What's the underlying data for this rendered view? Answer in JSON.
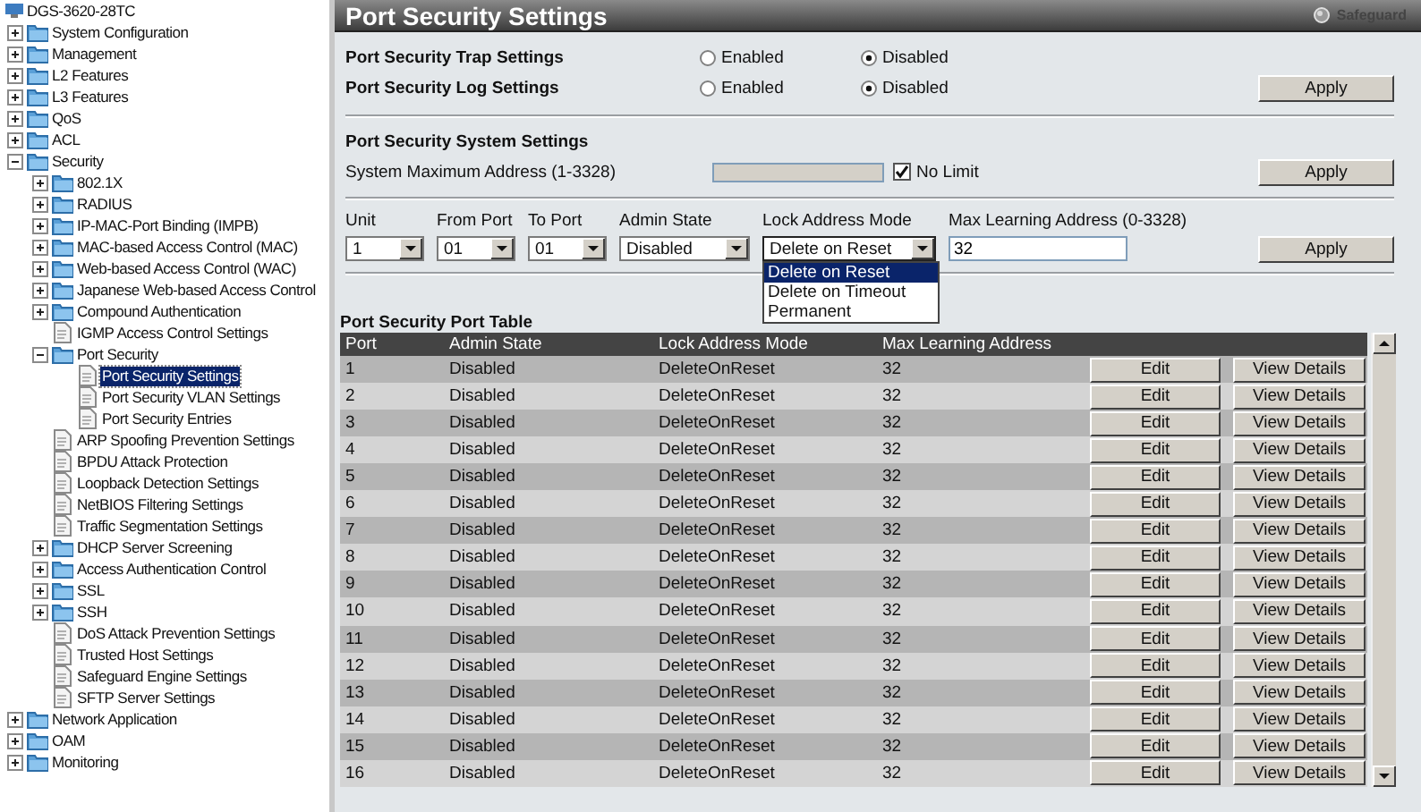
{
  "tree": {
    "root": "DGS-3620-28TC",
    "items": [
      {
        "label": "System Configuration",
        "kind": "folder",
        "expanded": false,
        "selected": false
      },
      {
        "label": "Management",
        "kind": "folder",
        "expanded": false,
        "selected": false
      },
      {
        "label": "L2 Features",
        "kind": "folder",
        "expanded": false,
        "selected": false
      },
      {
        "label": "L3 Features",
        "kind": "folder",
        "expanded": false,
        "selected": false
      },
      {
        "label": "QoS",
        "kind": "folder",
        "expanded": false,
        "selected": false
      },
      {
        "label": "ACL",
        "kind": "folder",
        "expanded": false,
        "selected": false
      },
      {
        "label": "Security",
        "kind": "folder",
        "expanded": true,
        "selected": false,
        "children": [
          {
            "label": "802.1X",
            "kind": "folder",
            "expanded": false,
            "selected": false
          },
          {
            "label": "RADIUS",
            "kind": "folder",
            "expanded": false,
            "selected": false
          },
          {
            "label": "IP-MAC-Port Binding (IMPB)",
            "kind": "folder",
            "expanded": false,
            "selected": false
          },
          {
            "label": "MAC-based Access Control (MAC)",
            "kind": "folder",
            "expanded": false,
            "selected": false
          },
          {
            "label": "Web-based Access Control (WAC)",
            "kind": "folder",
            "expanded": false,
            "selected": false
          },
          {
            "label": "Japanese Web-based Access Control",
            "kind": "folder",
            "expanded": false,
            "selected": false
          },
          {
            "label": "Compound Authentication",
            "kind": "folder",
            "expanded": false,
            "selected": false
          },
          {
            "label": "IGMP Access Control Settings",
            "kind": "page",
            "selected": false
          },
          {
            "label": "Port Security",
            "kind": "folder",
            "expanded": true,
            "selected": false,
            "children": [
              {
                "label": "Port Security Settings",
                "kind": "page",
                "selected": true
              },
              {
                "label": "Port Security VLAN Settings",
                "kind": "page",
                "selected": false
              },
              {
                "label": "Port Security Entries",
                "kind": "page",
                "selected": false
              }
            ]
          },
          {
            "label": "ARP Spoofing Prevention Settings",
            "kind": "page",
            "selected": false
          },
          {
            "label": "BPDU Attack Protection",
            "kind": "page",
            "selected": false
          },
          {
            "label": "Loopback Detection Settings",
            "kind": "page",
            "selected": false
          },
          {
            "label": "NetBIOS Filtering Settings",
            "kind": "page",
            "selected": false
          },
          {
            "label": "Traffic Segmentation Settings",
            "kind": "page",
            "selected": false
          },
          {
            "label": "DHCP Server Screening",
            "kind": "folder",
            "expanded": false,
            "selected": false
          },
          {
            "label": "Access Authentication Control",
            "kind": "folder",
            "expanded": false,
            "selected": false
          },
          {
            "label": "SSL",
            "kind": "folder",
            "expanded": false,
            "selected": false
          },
          {
            "label": "SSH",
            "kind": "folder",
            "expanded": false,
            "selected": false
          },
          {
            "label": "DoS Attack Prevention Settings",
            "kind": "page",
            "selected": false
          },
          {
            "label": "Trusted Host Settings",
            "kind": "page",
            "selected": false
          },
          {
            "label": "Safeguard Engine Settings",
            "kind": "page",
            "selected": false
          },
          {
            "label": "SFTP Server Settings",
            "kind": "page",
            "selected": false
          }
        ]
      },
      {
        "label": "Network Application",
        "kind": "folder",
        "expanded": false,
        "selected": false
      },
      {
        "label": "OAM",
        "kind": "folder",
        "expanded": false,
        "selected": false
      },
      {
        "label": "Monitoring",
        "kind": "folder",
        "expanded": false,
        "selected": false
      }
    ]
  },
  "page": {
    "title": "Port Security Settings",
    "safeguard": "Safeguard"
  },
  "global_settings": {
    "rows": [
      {
        "label": "Port Security Trap Settings",
        "options": [
          {
            "label": "Enabled",
            "selected": false
          },
          {
            "label": "Disabled",
            "selected": true
          }
        ]
      },
      {
        "label": "Port Security Log Settings",
        "options": [
          {
            "label": "Enabled",
            "selected": false
          },
          {
            "label": "Disabled",
            "selected": true
          }
        ]
      }
    ],
    "apply": "Apply"
  },
  "system_settings": {
    "heading": "Port Security System Settings",
    "label": "System Maximum Address (1-3328)",
    "no_limit": {
      "label": "No Limit",
      "checked": true
    },
    "apply": "Apply"
  },
  "port_form": {
    "fields": [
      {
        "label": "Unit",
        "kind": "select",
        "value": "1",
        "open": false
      },
      {
        "label": "From Port",
        "kind": "select",
        "value": "01",
        "open": false
      },
      {
        "label": "To Port",
        "kind": "select",
        "value": "01",
        "open": false
      },
      {
        "label": "Admin State",
        "kind": "select",
        "value": "Disabled",
        "open": false
      },
      {
        "label": "Lock Address Mode",
        "kind": "select",
        "value": "Delete on Reset",
        "open": true,
        "options": [
          {
            "label": "Delete on Reset",
            "selected": true
          },
          {
            "label": "Delete on Timeout",
            "selected": false
          },
          {
            "label": "Permanent",
            "selected": false
          }
        ]
      },
      {
        "label": "Max Learning Address (0-3328)",
        "kind": "input",
        "value": "32"
      }
    ],
    "apply": "Apply"
  },
  "port_table": {
    "title": "Port Security Port Table",
    "columns": [
      "Port",
      "Admin State",
      "Lock Address Mode",
      "Max Learning Address"
    ],
    "rows": [
      {
        "port": "1",
        "admin_state": "Disabled",
        "lock_mode": "DeleteOnReset",
        "max": "32",
        "edit": "Edit",
        "view": "View Details"
      },
      {
        "port": "2",
        "admin_state": "Disabled",
        "lock_mode": "DeleteOnReset",
        "max": "32",
        "edit": "Edit",
        "view": "View Details"
      },
      {
        "port": "3",
        "admin_state": "Disabled",
        "lock_mode": "DeleteOnReset",
        "max": "32",
        "edit": "Edit",
        "view": "View Details"
      },
      {
        "port": "4",
        "admin_state": "Disabled",
        "lock_mode": "DeleteOnReset",
        "max": "32",
        "edit": "Edit",
        "view": "View Details"
      },
      {
        "port": "5",
        "admin_state": "Disabled",
        "lock_mode": "DeleteOnReset",
        "max": "32",
        "edit": "Edit",
        "view": "View Details"
      },
      {
        "port": "6",
        "admin_state": "Disabled",
        "lock_mode": "DeleteOnReset",
        "max": "32",
        "edit": "Edit",
        "view": "View Details"
      },
      {
        "port": "7",
        "admin_state": "Disabled",
        "lock_mode": "DeleteOnReset",
        "max": "32",
        "edit": "Edit",
        "view": "View Details"
      },
      {
        "port": "8",
        "admin_state": "Disabled",
        "lock_mode": "DeleteOnReset",
        "max": "32",
        "edit": "Edit",
        "view": "View Details"
      },
      {
        "port": "9",
        "admin_state": "Disabled",
        "lock_mode": "DeleteOnReset",
        "max": "32",
        "edit": "Edit",
        "view": "View Details"
      },
      {
        "port": "10",
        "admin_state": "Disabled",
        "lock_mode": "DeleteOnReset",
        "max": "32",
        "edit": "Edit",
        "view": "View Details"
      },
      {
        "port": "11",
        "admin_state": "Disabled",
        "lock_mode": "DeleteOnReset",
        "max": "32",
        "edit": "Edit",
        "view": "View Details"
      },
      {
        "port": "12",
        "admin_state": "Disabled",
        "lock_mode": "DeleteOnReset",
        "max": "32",
        "edit": "Edit",
        "view": "View Details"
      },
      {
        "port": "13",
        "admin_state": "Disabled",
        "lock_mode": "DeleteOnReset",
        "max": "32",
        "edit": "Edit",
        "view": "View Details"
      },
      {
        "port": "14",
        "admin_state": "Disabled",
        "lock_mode": "DeleteOnReset",
        "max": "32",
        "edit": "Edit",
        "view": "View Details"
      },
      {
        "port": "15",
        "admin_state": "Disabled",
        "lock_mode": "DeleteOnReset",
        "max": "32",
        "edit": "Edit",
        "view": "View Details"
      },
      {
        "port": "16",
        "admin_state": "Disabled",
        "lock_mode": "DeleteOnReset",
        "max": "32",
        "edit": "Edit",
        "view": "View Details"
      }
    ]
  }
}
